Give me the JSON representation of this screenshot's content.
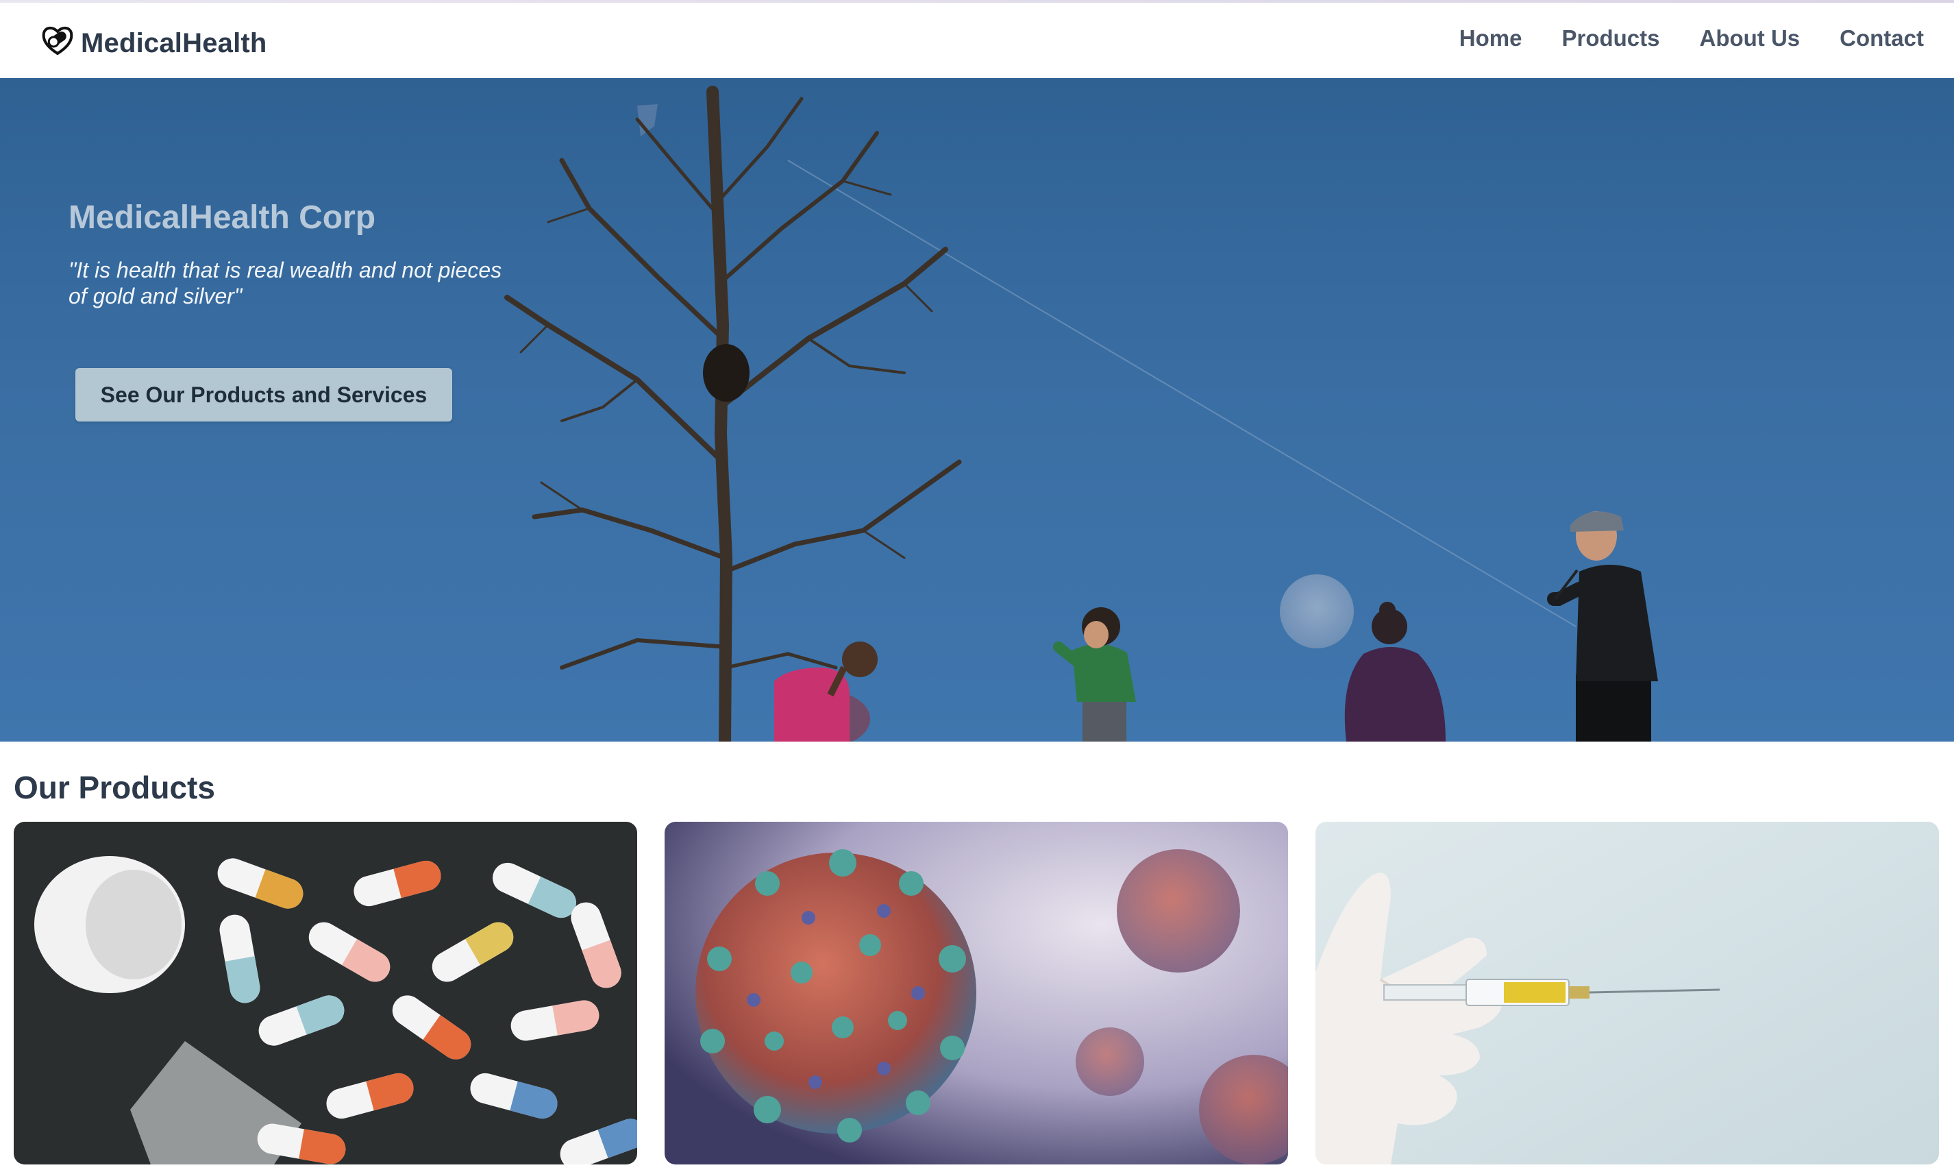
{
  "brand": {
    "name": "MedicalHealth",
    "logo_icon": "capsule-heart-icon"
  },
  "nav": {
    "items": [
      {
        "label": "Home"
      },
      {
        "label": "Products"
      },
      {
        "label": "About Us"
      },
      {
        "label": "Contact"
      }
    ]
  },
  "hero": {
    "title": "MedicalHealth Corp",
    "quote": "\"It is health that is real wealth and not pieces of gold and silver\"",
    "cta_label": "See Our Products and Services",
    "image": "family-under-tree-photo"
  },
  "products": {
    "heading": "Our Products",
    "cards": [
      {
        "image": "capsule-pills-photo"
      },
      {
        "image": "virus-illustration"
      },
      {
        "image": "syringe-vaccine-photo"
      }
    ]
  },
  "colors": {
    "hero_sky": "#3a6ea3",
    "heading_text": "#2d3a4b",
    "nav_text": "#4a5668",
    "cta_button": "#b3c7d2"
  }
}
